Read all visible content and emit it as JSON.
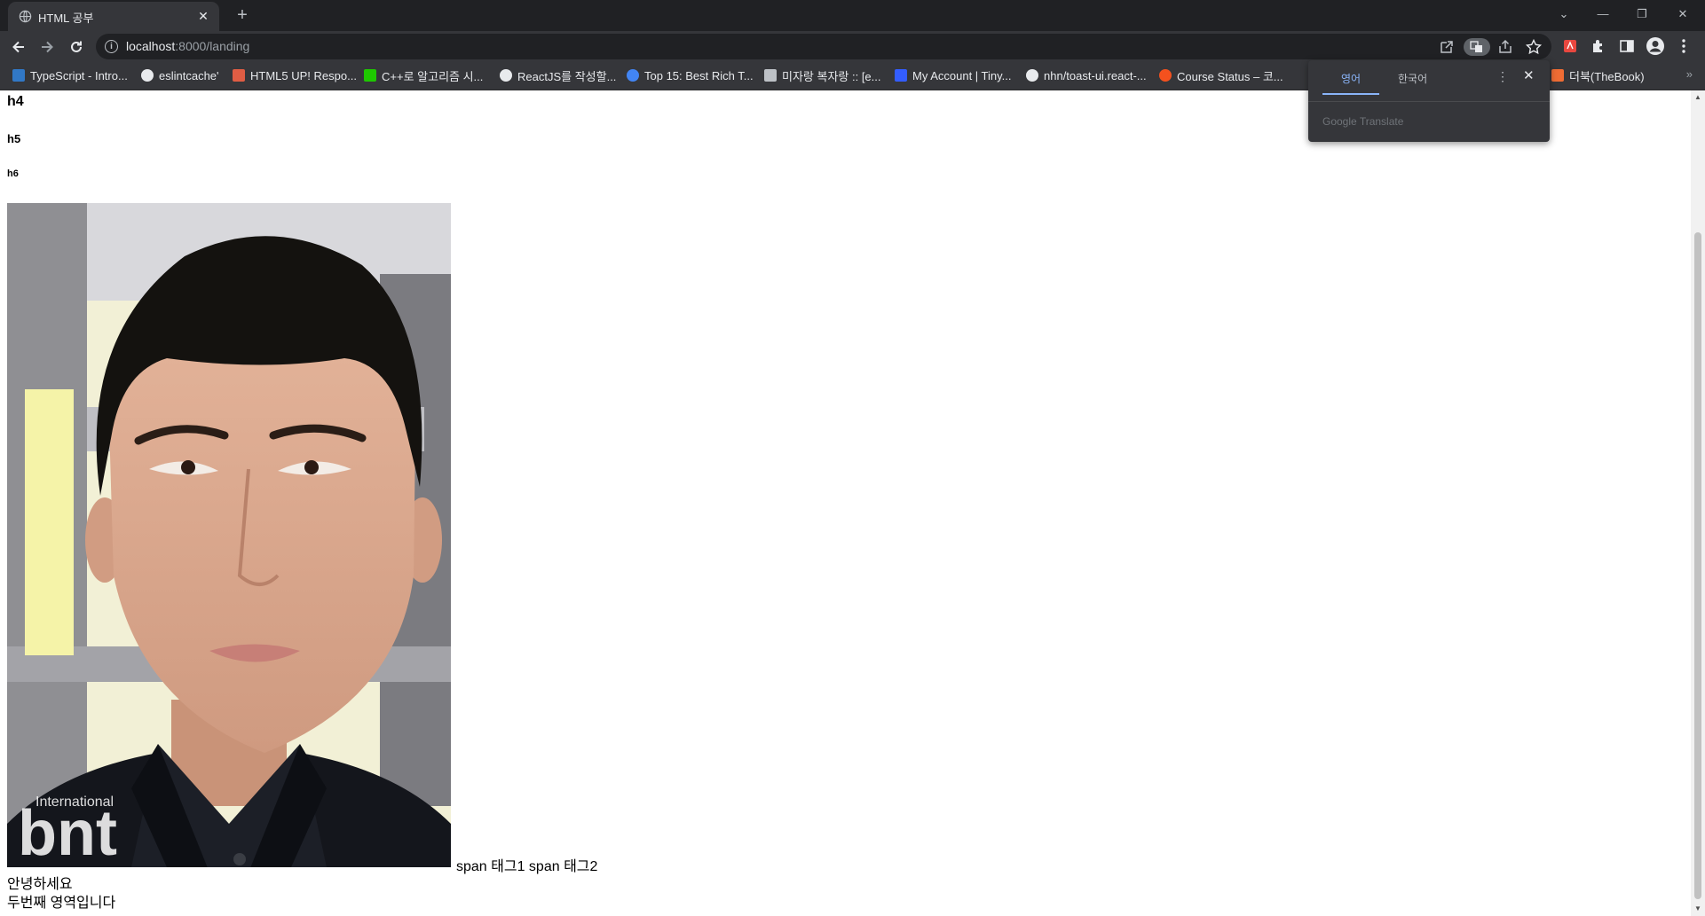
{
  "browser": {
    "tab": {
      "title": "HTML 공부",
      "close": "✕"
    },
    "new_tab": "+",
    "window_controls": {
      "list": "⌄",
      "minimize": "—",
      "restore": "❐",
      "close": "✕"
    },
    "url": {
      "host": "localhost",
      "rest": ":8000/landing"
    }
  },
  "bookmarks": [
    {
      "label": "TypeScript - Intro...",
      "color": "#3178c6"
    },
    {
      "label": "eslintcache'",
      "color": "#e8eaed"
    },
    {
      "label": "HTML5 UP! Respo...",
      "color": "#e05d44"
    },
    {
      "label": "C++로 알고리즘 시...",
      "color": "#1ec800"
    },
    {
      "label": "ReactJS를 작성할...",
      "color": "#e8eaed"
    },
    {
      "label": "Top 15: Best Rich T...",
      "color": "#4285f4"
    },
    {
      "label": "미자랑 복자랑 :: [e...",
      "color": "#bdc1c6"
    },
    {
      "label": "My Account | Tiny...",
      "color": "#335dff"
    },
    {
      "label": "nhn/toast-ui.react-...",
      "color": "#e8eaed"
    },
    {
      "label": "Course Status – 코...",
      "color": "#f4511e"
    },
    {
      "label": "더북(TheBook)",
      "color": "#ef6c34"
    }
  ],
  "bookmarks_more": "»",
  "translate_popup": {
    "tab_source": "영어",
    "tab_target": "한국어",
    "brand": "Google Translate"
  },
  "page": {
    "h4": "h4",
    "h5": "h5",
    "h6": "h6",
    "image_watermark": {
      "small": "International",
      "large": "bnt"
    },
    "spans": "span 태그1 span 태그2",
    "line1": "안녕하세요",
    "line2": "두번째 영역입니다"
  }
}
